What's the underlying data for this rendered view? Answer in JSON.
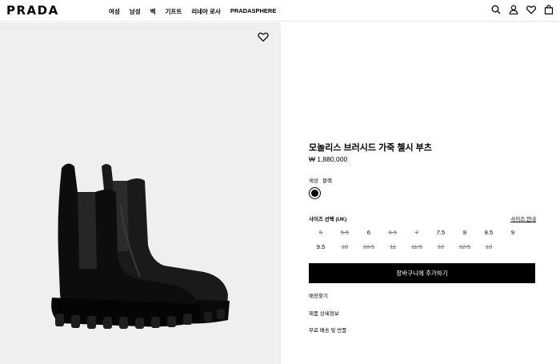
{
  "header": {
    "logo": "PRADA",
    "nav": [
      "여성",
      "남성",
      "백",
      "기프트",
      "리네아 로사",
      "PRADASPHERE"
    ],
    "icons": [
      "search-icon",
      "account-icon",
      "wishlist-heart-icon",
      "shopping-bag-icon"
    ]
  },
  "product": {
    "title": "모놀리스 브러시드 가죽 첼시 부츠",
    "price": "₩ 1,880,000",
    "color_label": "색상",
    "color_value": "블랙",
    "swatch_color": "#000000",
    "size_label": "사이즈 선택 (UK)",
    "size_guide": "사이즈 안내",
    "sizes": [
      {
        "label": "5",
        "available": false
      },
      {
        "label": "5.5",
        "available": false
      },
      {
        "label": "6",
        "available": true
      },
      {
        "label": "6.5",
        "available": false
      },
      {
        "label": "7",
        "available": false
      },
      {
        "label": "7.5",
        "available": true
      },
      {
        "label": "8",
        "available": true
      },
      {
        "label": "8.5",
        "available": true
      },
      {
        "label": "9",
        "available": true
      },
      {
        "label": "9.5",
        "available": true
      },
      {
        "label": "10",
        "available": false
      },
      {
        "label": "10.5",
        "available": false
      },
      {
        "label": "11",
        "available": false
      },
      {
        "label": "11.5",
        "available": false
      },
      {
        "label": "12",
        "available": false
      },
      {
        "label": "12.5",
        "available": false
      },
      {
        "label": "13",
        "available": false
      }
    ],
    "add_to_cart": "장바구니에 추가하기",
    "links": [
      "매장찾기",
      "제품 상세정보",
      "무료 배송 및 반품"
    ]
  },
  "image_panel": {
    "background": "#efeff1",
    "wishlist_icon": "heart-icon"
  }
}
